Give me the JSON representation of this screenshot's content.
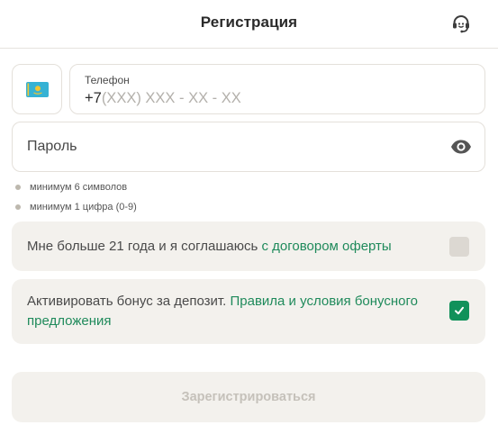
{
  "header": {
    "title": "Регистрация",
    "support_icon": "headset-icon"
  },
  "phone": {
    "country_flag_icon": "kazakhstan-flag-icon",
    "label": "Телефон",
    "prefix": "+7",
    "placeholder_mask": "(XXX) XXX - XX - XX"
  },
  "password": {
    "placeholder": "Пароль",
    "toggle_icon": "eye-icon"
  },
  "hints": [
    {
      "text": "минимум 6 символов"
    },
    {
      "text": "минимум 1 цифра (0-9)"
    }
  ],
  "agreements": [
    {
      "text": "Мне больше 21 года и я соглашаюсь ",
      "link": "с договором оферты",
      "checked": false
    },
    {
      "text": "Активировать бонус за депозит. ",
      "link": "Правила и условия бонусного предложения",
      "checked": true
    }
  ],
  "submit": {
    "label": "Зарегистрироваться",
    "disabled": true
  },
  "colors": {
    "accent_green": "#11915a",
    "link_green": "#1f8a5b",
    "row_background": "#f3f1ed",
    "disabled_text": "#c5c1ba"
  }
}
